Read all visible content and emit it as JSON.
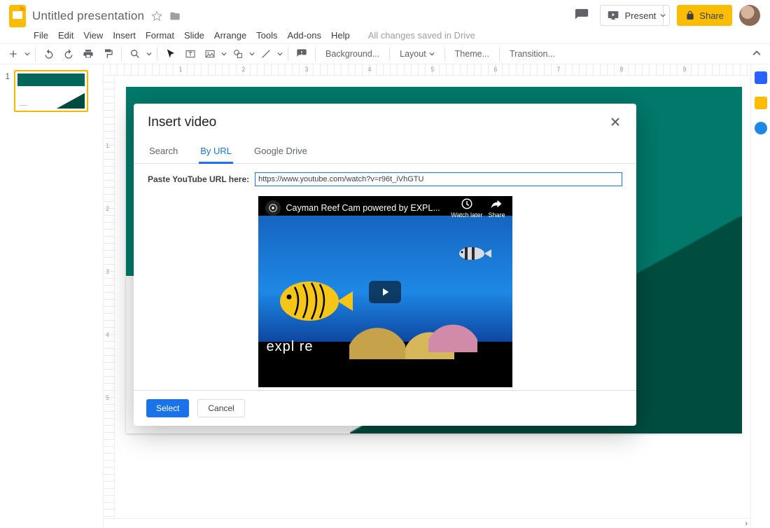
{
  "header": {
    "doc_title": "Untitled presentation",
    "present_label": "Present",
    "share_label": "Share"
  },
  "menu": {
    "items": [
      "File",
      "Edit",
      "View",
      "Insert",
      "Format",
      "Slide",
      "Arrange",
      "Tools",
      "Add-ons",
      "Help"
    ],
    "saved_status": "All changes saved in Drive"
  },
  "toolbar": {
    "background_label": "Background...",
    "layout_label": "Layout",
    "theme_label": "Theme...",
    "transition_label": "Transition..."
  },
  "slides_panel": {
    "current_index": "1"
  },
  "ruler_h": [
    "",
    "1",
    "",
    "2",
    "",
    "3",
    "",
    "4",
    "",
    "5",
    "",
    "6",
    "",
    "7",
    "",
    "8",
    "",
    "9",
    ""
  ],
  "ruler_v": [
    "",
    "1",
    "",
    "2",
    "",
    "3",
    "",
    "4",
    "",
    "5",
    ""
  ],
  "modal": {
    "title": "Insert video",
    "tabs": {
      "search": "Search",
      "by_url": "By URL",
      "drive": "Google Drive"
    },
    "active_tab": "by_url",
    "url_label": "Paste YouTube URL here:",
    "url_value": "https://www.youtube.com/watch?v=r96t_iVhGTU",
    "video_title": "Cayman Reef Cam powered by EXPL...",
    "watch_later": "Watch later",
    "share_video": "Share",
    "explore_text": "expl   re",
    "select_label": "Select",
    "cancel_label": "Cancel"
  }
}
